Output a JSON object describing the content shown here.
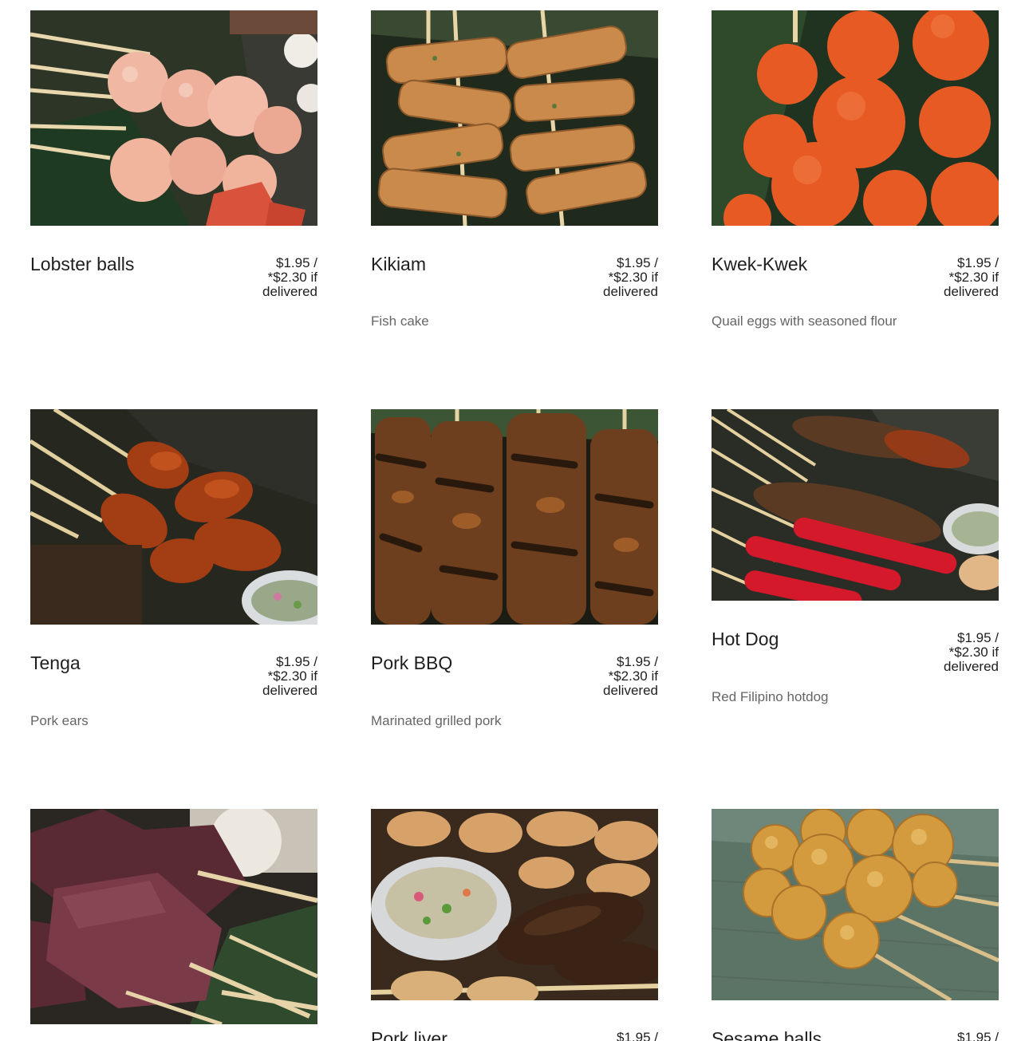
{
  "menu": {
    "items": [
      {
        "name": "Lobster balls",
        "price_line1": "$1.95 /",
        "price_line2": "*$2.30 if",
        "price_line3": "delivered",
        "description": "",
        "photo": "lobster-balls-photo"
      },
      {
        "name": "Kikiam",
        "price_line1": "$1.95 /",
        "price_line2": "*$2.30 if",
        "price_line3": "delivered",
        "description": "Fish cake",
        "photo": "kikiam-photo"
      },
      {
        "name": "Kwek-Kwek",
        "price_line1": "$1.95 /",
        "price_line2": "*$2.30 if",
        "price_line3": "delivered",
        "description": "Quail eggs with seasoned flour",
        "photo": "kwek-kwek-photo"
      },
      {
        "name": "Tenga",
        "price_line1": "$1.95 /",
        "price_line2": "*$2.30 if",
        "price_line3": "delivered",
        "description": "Pork ears",
        "photo": "tenga-photo"
      },
      {
        "name": "Pork BBQ",
        "price_line1": "$1.95 /",
        "price_line2": "*$2.30 if",
        "price_line3": "delivered",
        "description": "Marinated  grilled pork",
        "photo": "pork-bbq-photo"
      },
      {
        "name": "Hot Dog",
        "price_line1": "$1.95 /",
        "price_line2": "*$2.30 if",
        "price_line3": "delivered",
        "description": "Red Filipino hotdog",
        "photo": "hot-dog-photo"
      },
      {
        "name": "",
        "price_line1": "",
        "price_line2": "",
        "price_line3": "",
        "description": "",
        "photo": "blood-cake-photo"
      },
      {
        "name": "Pork liver",
        "price_line1": "$1.95 /",
        "price_line2": "",
        "price_line3": "",
        "description": "",
        "photo": "pork-liver-photo"
      },
      {
        "name": "Sesame balls",
        "price_line1": "$1.95 /",
        "price_line2": "",
        "price_line3": "",
        "description": "",
        "photo": "sesame-balls-photo"
      }
    ]
  },
  "colors": {
    "background": "#ffffff",
    "text": "#1f1f1f",
    "description": "#666666"
  }
}
